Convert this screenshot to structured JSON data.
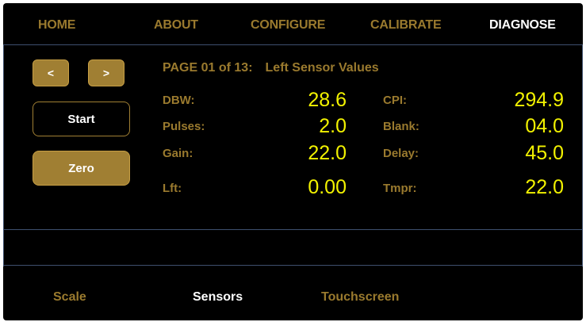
{
  "tabs": [
    {
      "label": "HOME",
      "active": false
    },
    {
      "label": "ABOUT",
      "active": false
    },
    {
      "label": "CONFIGURE",
      "active": false
    },
    {
      "label": "CALIBRATE",
      "active": false
    },
    {
      "label": "DIAGNOSE",
      "active": true
    }
  ],
  "controls": {
    "prev_label": "<",
    "next_label": ">",
    "start_label": "Start",
    "zero_label": "Zero"
  },
  "page": {
    "indicator": "PAGE 01 of 13:",
    "title": "Left Sensor Values"
  },
  "readings": {
    "left": [
      {
        "label": "DBW:",
        "value": "28.6"
      },
      {
        "label": "Pulses:",
        "value": "2.0"
      },
      {
        "label": "Gain:",
        "value": "22.0"
      },
      {
        "label": "Lft:",
        "value": "0.00"
      }
    ],
    "right": [
      {
        "label": "CPI:",
        "value": "294.9"
      },
      {
        "label": "Blank:",
        "value": "04.0"
      },
      {
        "label": "Delay:",
        "value": "45.0"
      },
      {
        "label": "Tmpr:",
        "value": "22.0"
      }
    ]
  },
  "subtabs": [
    {
      "label": "Scale",
      "active": false
    },
    {
      "label": "Sensors",
      "active": true
    },
    {
      "label": "Touchscreen",
      "active": false
    }
  ],
  "colors": {
    "background": "#000000",
    "accent_gold": "#a07f33",
    "label_gold": "#9a7a2e",
    "value_yellow": "#f2f200",
    "active_white": "#ffffff",
    "divider_blue": "#3e4f6e"
  }
}
